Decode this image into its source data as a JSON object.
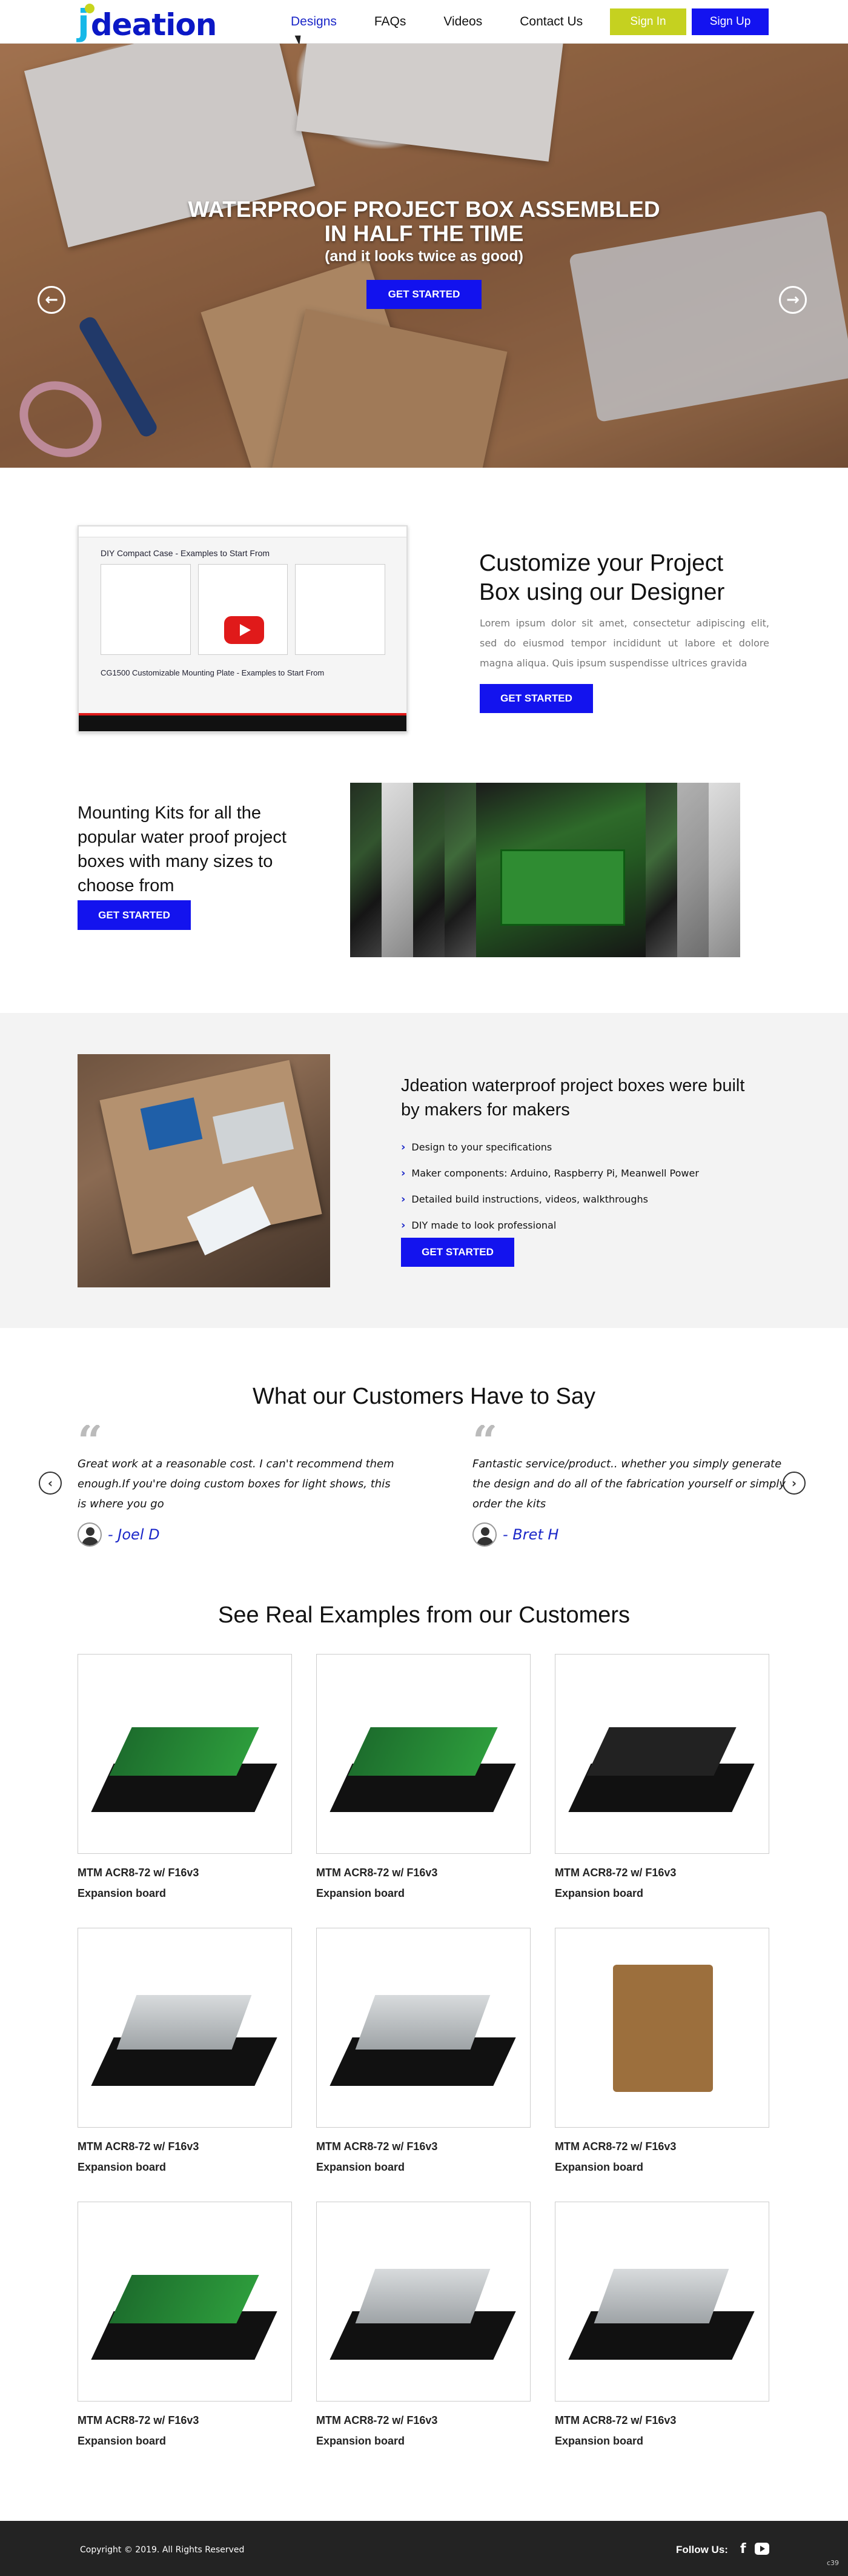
{
  "nav": {
    "logo_j": "j",
    "logo_text": "deation",
    "links": [
      "Designs",
      "FAQs",
      "Videos",
      "Contact Us"
    ],
    "signin": "Sign In",
    "signup": "Sign Up"
  },
  "hero": {
    "title_line1": "WATERPROOF PROJECT BOX ASSEMBLED",
    "title_line2": "IN HALF THE TIME",
    "subtitle": "(and it looks twice as good)",
    "cta": "GET STARTED",
    "slide_count": 3,
    "active_slide": 1
  },
  "designer": {
    "video_title": "DIY Compact Case - Examples to Start From",
    "video_subtitle": "CG1500 Customizable Mounting Plate - Examples to Start From",
    "heading": "Customize your Project Box using our Designer",
    "body": "Lorem ipsum dolor sit amet, consectetur adipiscing elit, sed do eiusmod tempor incididunt ut labore et dolore magna aliqua. Quis ipsum suspendisse ultrices gravida",
    "cta": "GET STARTED"
  },
  "mounting": {
    "heading": "Mounting Kits for all the popular water proof project boxes with many sizes to choose from",
    "cta": "GET STARTED"
  },
  "makers": {
    "heading": "Jdeation waterproof project boxes were built by makers for makers",
    "bullets": [
      "Design to your specifications",
      "Maker components: Arduino, Raspberry Pi,  Meanwell Power",
      "Detailed build instructions, videos, walkthroughs",
      "DIY made to look professional"
    ],
    "cta": "GET STARTED"
  },
  "testimonials": {
    "title": "What our Customers Have to Say",
    "items": [
      {
        "text": "Great work at a reasonable cost. I can't recommend them enough.If you're doing custom boxes for light shows, this is where you go",
        "author": "- Joel D"
      },
      {
        "text": "Fantastic service/product.. whether you simply generate the design and do all of the fabrication yourself or simply order the kits",
        "author": "- Bret H"
      }
    ]
  },
  "examples": {
    "title": "See Real Examples from our Customers",
    "cards": [
      {
        "line1": "MTM ACR8-72 w/ F16v3",
        "line2": "Expansion board"
      },
      {
        "line1": "MTM ACR8-72 w/ F16v3",
        "line2": "Expansion board"
      },
      {
        "line1": "MTM ACR8-72 w/ F16v3",
        "line2": "Expansion board"
      },
      {
        "line1": "MTM ACR8-72 w/ F16v3",
        "line2": "Expansion board"
      },
      {
        "line1": "MTM ACR8-72 w/ F16v3",
        "line2": "Expansion board"
      },
      {
        "line1": "MTM ACR8-72 w/ F16v3",
        "line2": "Expansion board"
      },
      {
        "line1": "MTM ACR8-72 w/ F16v3",
        "line2": "Expansion board"
      },
      {
        "line1": "MTM ACR8-72 w/ F16v3",
        "line2": "Expansion board"
      },
      {
        "line1": "MTM ACR8-72 w/ F16v3",
        "line2": "Expansion board"
      }
    ]
  },
  "footer": {
    "copyright": "Copyright © 2019. All Rights Reserved",
    "follow": "Follow Us:",
    "corner": "c39"
  },
  "icons": {
    "prev": "arrow-left-icon",
    "next": "arrow-right-icon",
    "bullet": "chevron-right-icon",
    "quote": "quote-icon",
    "facebook": "facebook-icon",
    "youtube": "youtube-icon"
  },
  "colors": {
    "brand_blue": "#1313ee",
    "signin_lime": "#c5d120",
    "logo_cyan": "#16b8e8",
    "footer_bg": "#232323"
  }
}
